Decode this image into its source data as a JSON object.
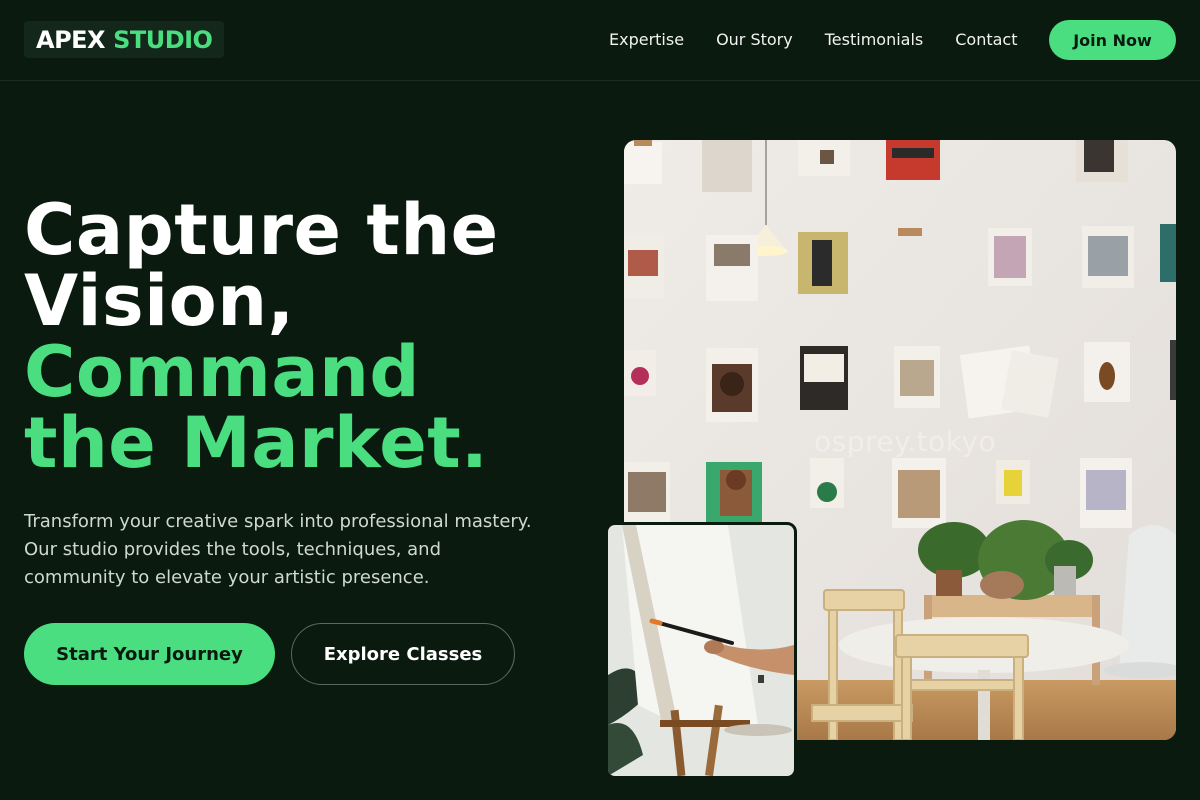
{
  "header": {
    "logo": {
      "word1": "APEX",
      "word2": "STUDIO"
    },
    "nav": [
      "Expertise",
      "Our Story",
      "Testimonials",
      "Contact"
    ],
    "cta_label": "Join Now"
  },
  "hero": {
    "headline_line1": "Capture the",
    "headline_line2": "Vision,",
    "headline_line3": "Command",
    "headline_line4": "the Market.",
    "subtext_line1": "Transform your creative spark into professional mastery.",
    "subtext_line2": "Our studio provides the tools, techniques, and",
    "subtext_line3": "community to elevate your artistic presence.",
    "primary_button": "Start Your Journey",
    "secondary_button": "Explore Classes"
  },
  "images": {
    "main_watermark": "osprey.tokyo"
  },
  "colors": {
    "background": "#0a1a0f",
    "accent": "#4ade80",
    "text": "#ffffff"
  }
}
